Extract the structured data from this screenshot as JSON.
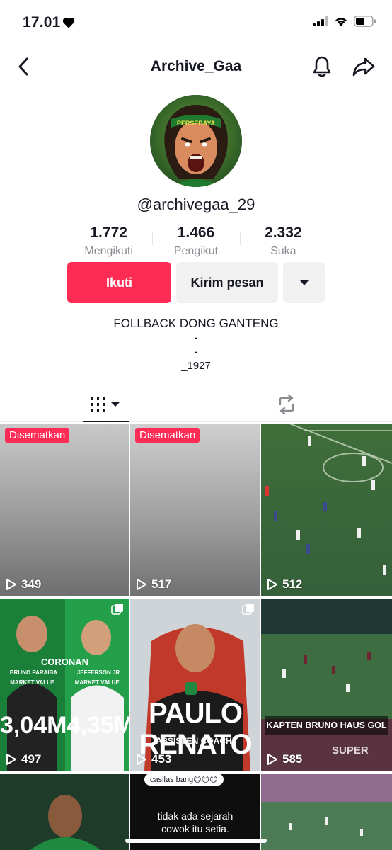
{
  "status": {
    "time": "17.01"
  },
  "nav": {
    "title": "Archive_Gaa"
  },
  "profile": {
    "handle": "@archivegaa_29",
    "avatar_text": "PERSEBAYA",
    "stats": [
      {
        "value": "1.772",
        "label": "Mengikuti"
      },
      {
        "value": "1.466",
        "label": "Pengikut"
      },
      {
        "value": "2.332",
        "label": "Suka"
      }
    ],
    "follow_label": "Ikuti",
    "message_label": "Kirim pesan",
    "bio_lines": [
      "FOLLBACK DONG GANTENG",
      "-",
      "-",
      "_1927"
    ]
  },
  "grid": [
    {
      "pinned": "Disematkan",
      "views": "349"
    },
    {
      "pinned": "Disematkan",
      "views": "517"
    },
    {
      "views": "512"
    },
    {
      "views": "497",
      "texts": [
        "CORONAN",
        "BRUNO PARAIBA",
        "JEFFERSON JR",
        "MARKET VALUE",
        "MARKET VALUE",
        "3,04M",
        "4,35M"
      ]
    },
    {
      "views": "453",
      "texts": [
        "PAULO RENATO",
        "ASSISTEN COACH!"
      ]
    },
    {
      "views": "585",
      "texts": [
        "KAPTEN BRUNO HAUS GOL",
        "SUPER"
      ]
    },
    {
      "views": ""
    },
    {
      "views": "",
      "texts": [
        "casilas bang😊😊😊",
        "tidak ada sejarah",
        "cowok itu setia."
      ]
    },
    {
      "views": ""
    }
  ],
  "colors": {
    "accent": "#fe2c55",
    "secondary_button": "#f1f1f2",
    "muted_text": "#8a8b91"
  },
  "icons": [
    "back-icon",
    "bell-icon",
    "share-icon",
    "grid-icon",
    "repost-icon",
    "play-icon",
    "multi-photo-icon",
    "chevron-down-icon"
  ]
}
